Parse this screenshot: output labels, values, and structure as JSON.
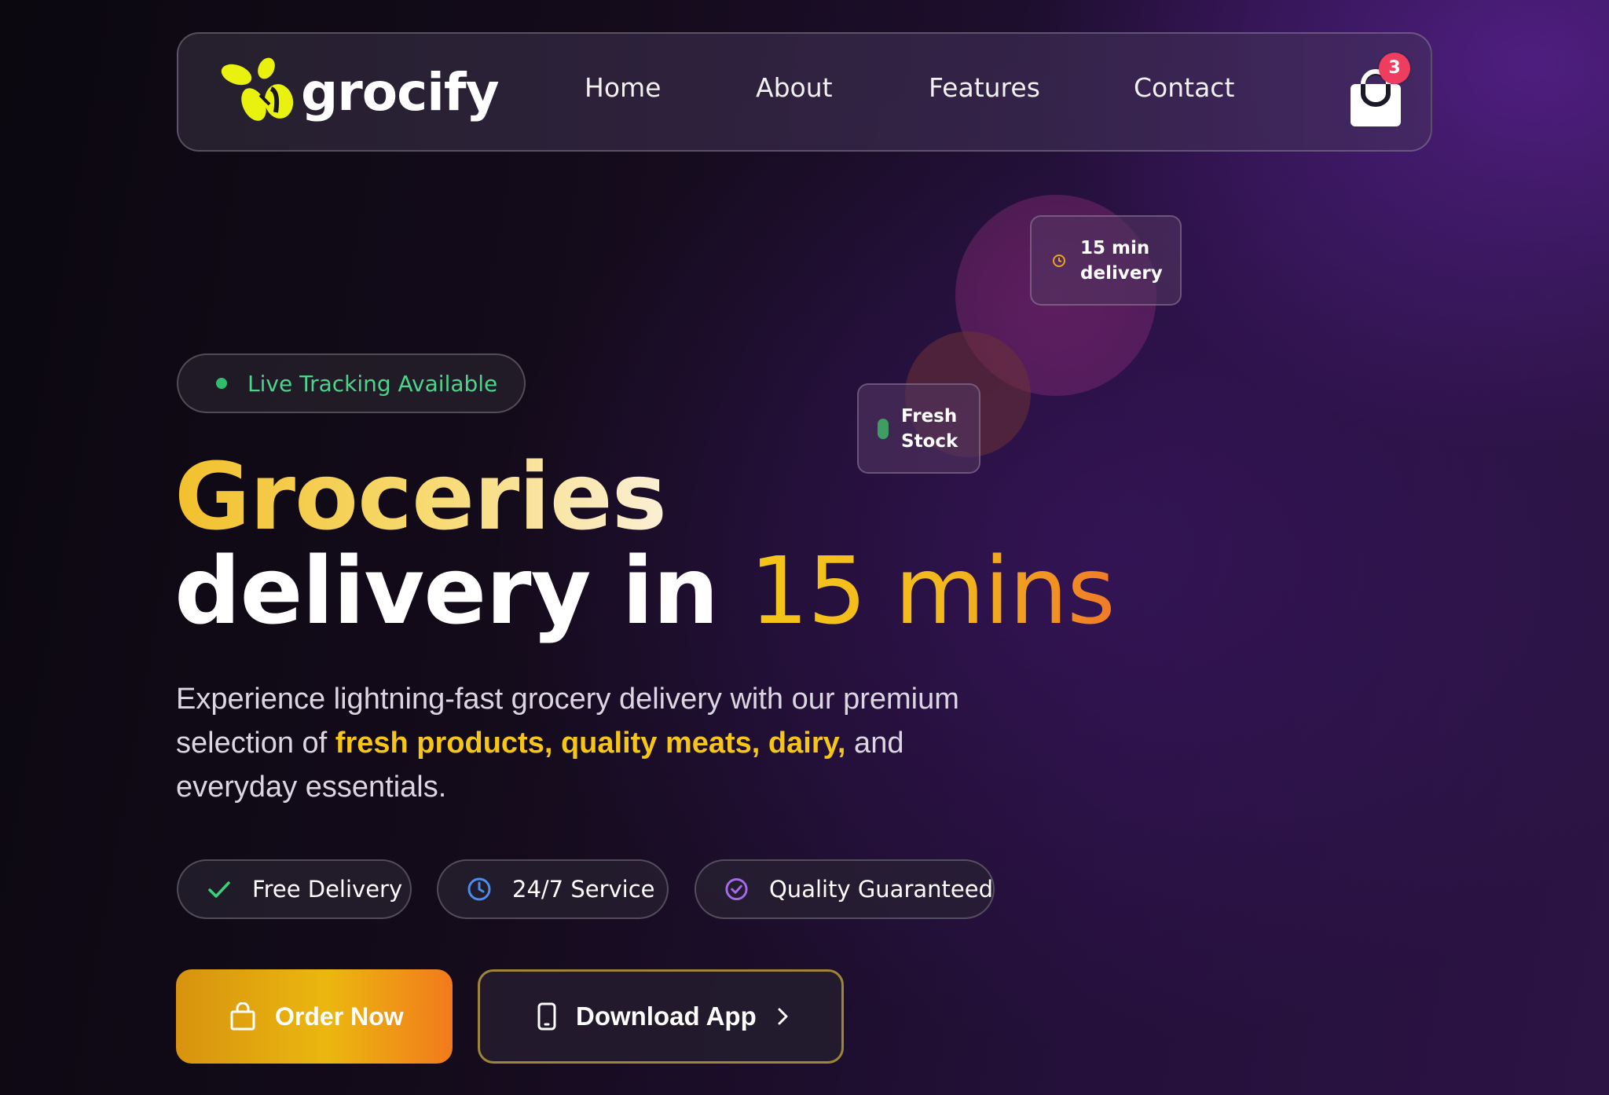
{
  "brand": {
    "name": "grocify"
  },
  "nav": {
    "items": [
      {
        "label": "Home"
      },
      {
        "label": "About"
      },
      {
        "label": "Features"
      },
      {
        "label": "Contact"
      }
    ],
    "cart_count": "3"
  },
  "floating_cards": {
    "delivery": {
      "line1": "15 min",
      "line2": "delivery",
      "icon": "clock-icon"
    },
    "stock": {
      "line1": "Fresh",
      "line2": "Stock"
    }
  },
  "hero": {
    "badge": "Live Tracking Available",
    "title_line1": "Groceries",
    "title_line2_main": "delivery in ",
    "title_line2_accent": "15 mins",
    "lead_part1": "Experience lightning-fast grocery delivery with our premium selection of ",
    "lead_highlight": "fresh products, quality meats, dairy,",
    "lead_part2": " and everyday essentials."
  },
  "features": [
    {
      "label": "Free Delivery",
      "icon": "check-icon"
    },
    {
      "label": "24/7 Service",
      "icon": "clock-icon"
    },
    {
      "label": "Quality Guaranteed",
      "icon": "check-circle-icon"
    }
  ],
  "cta": {
    "primary": "Order Now",
    "secondary": "Download App"
  },
  "colors": {
    "accent_yellow": "#f5c518",
    "accent_orange": "#f27a1c",
    "live_green": "#4ad68a",
    "badge_red": "#ee3d5e"
  }
}
